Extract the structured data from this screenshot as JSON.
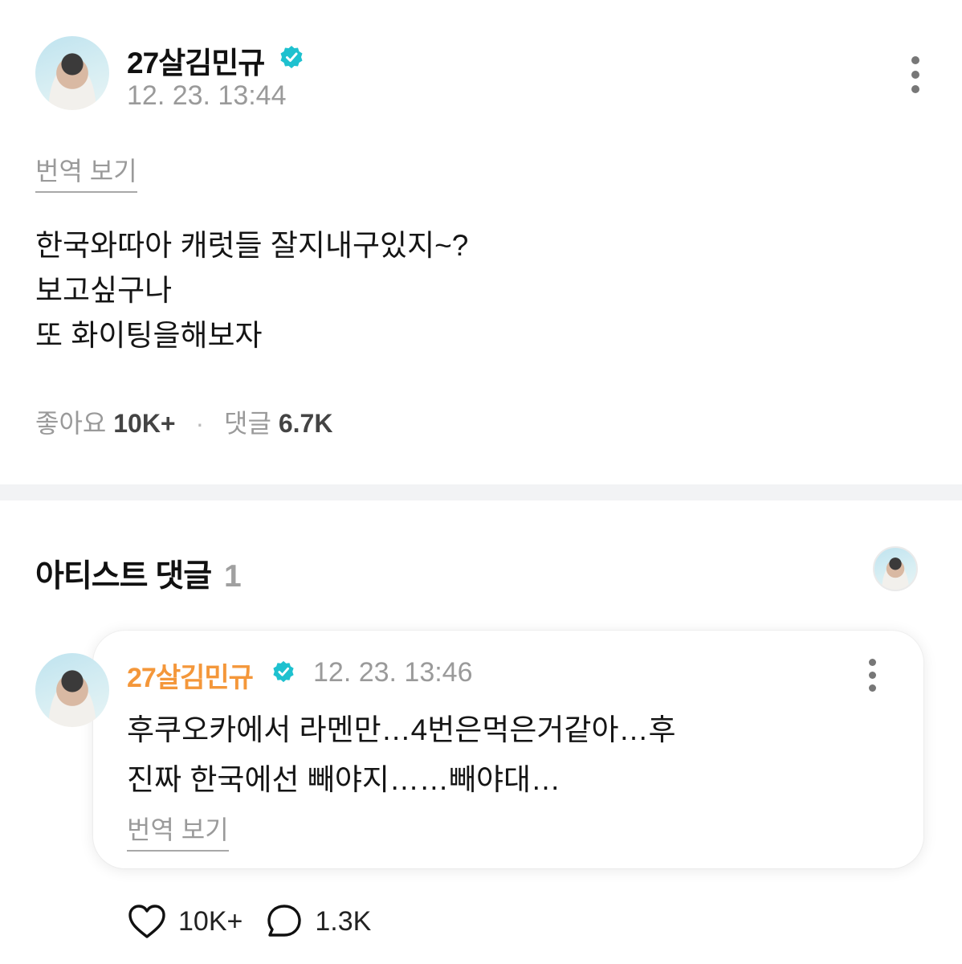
{
  "post": {
    "author": "27살김민규",
    "timestamp": "12. 23. 13:44",
    "translate_label": "번역 보기",
    "body_lines": [
      "한국와따아 캐럿들 잘지내구있지~?",
      "보고싶구나",
      "또 화이팅을해보자"
    ],
    "likes_label": "좋아요",
    "likes_count": "10K+",
    "comments_label": "댓글",
    "comments_count": "6.7K"
  },
  "artist_comments": {
    "title": "아티스트 댓글",
    "count": "1",
    "comment": {
      "author": "27살김민규",
      "timestamp": "12. 23. 13:46",
      "body_lines": [
        "후쿠오카에서 라멘만…4번은먹은거같아…후",
        "진짜 한국에선 빼야지……빼야대…"
      ],
      "translate_label": "번역 보기",
      "likes_count": "10K+",
      "replies_count": "1.3K"
    }
  },
  "colors": {
    "verified": "#1ec1cf",
    "artist_name": "#f4973a",
    "muted_text": "#9a9a9a",
    "divider": "#f2f3f5"
  },
  "icons": [
    "verified-badge-icon",
    "more-vertical-icon",
    "heart-icon",
    "comment-bubble-icon"
  ]
}
